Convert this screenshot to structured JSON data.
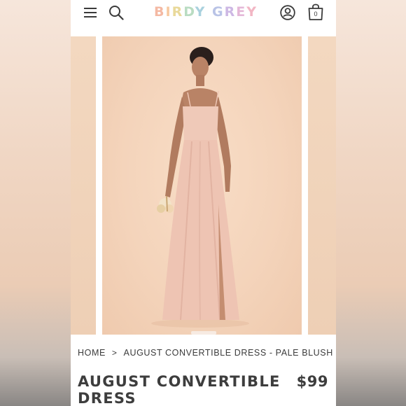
{
  "header": {
    "logo_text": "BIRDY GREY",
    "bag_count": "0",
    "icons": [
      "menu-icon",
      "search-icon",
      "account-icon",
      "shopping-bag-icon"
    ]
  },
  "gallery": {
    "background_color": "#f4d4bb",
    "dress_color": "#efc7b6"
  },
  "breadcrumb": {
    "home": "HOME",
    "separator": ">",
    "current": "AUGUST CONVERTIBLE DRESS - PALE BLUSH"
  },
  "product": {
    "title": "AUGUST CONVERTIBLE DRESS",
    "price": "$99"
  }
}
